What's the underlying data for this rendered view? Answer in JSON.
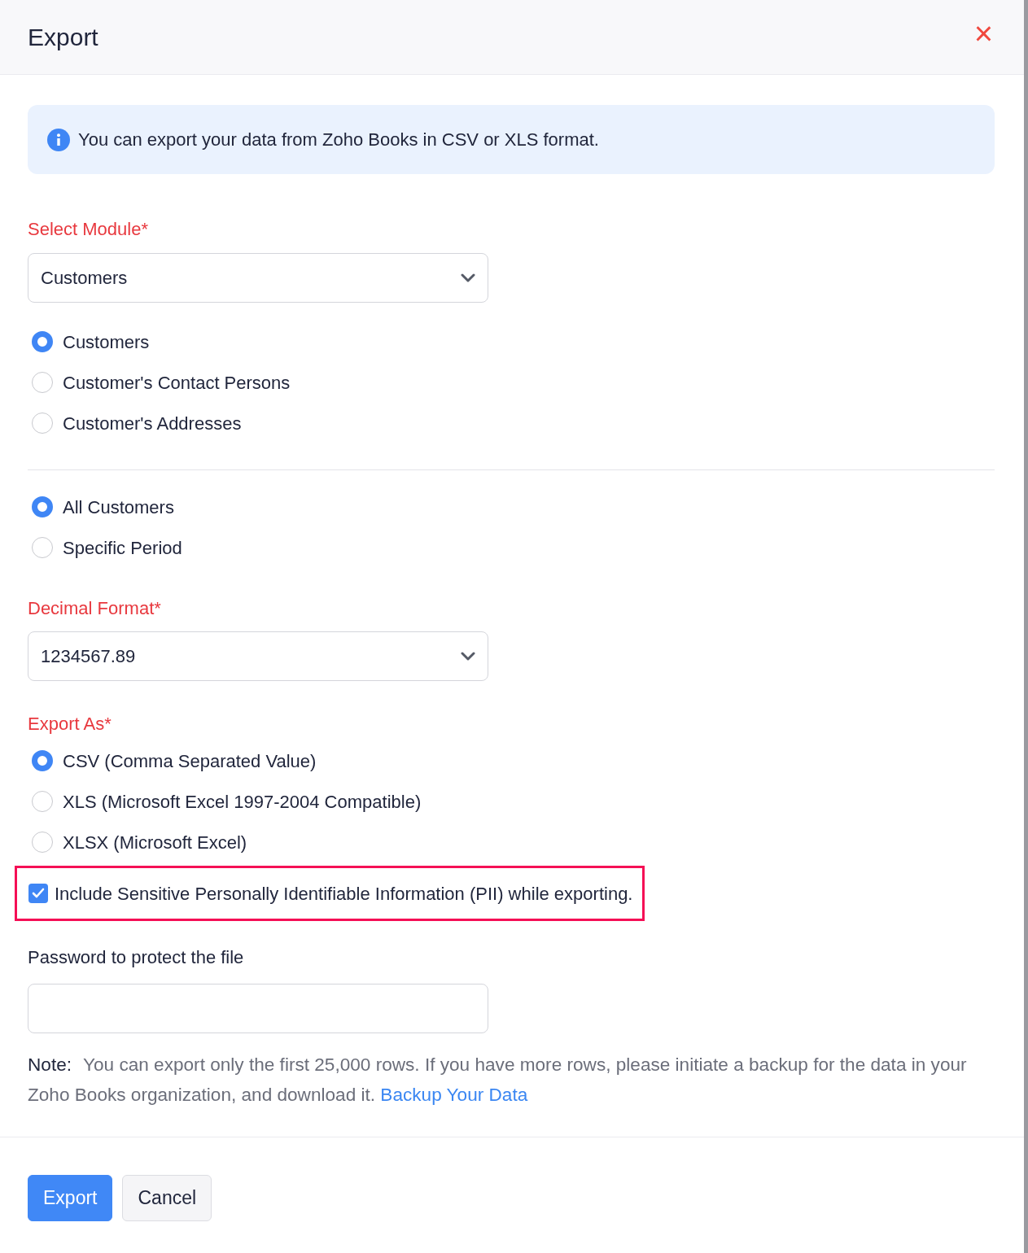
{
  "dialog": {
    "title": "Export",
    "close": "×"
  },
  "info_banner": {
    "text": "You can export your data from Zoho Books in CSV or XLS format."
  },
  "module": {
    "label": "Select Module*",
    "value": "Customers",
    "options": [
      {
        "label": "Customers",
        "selected": true
      },
      {
        "label": "Customer's Contact Persons",
        "selected": false
      },
      {
        "label": "Customer's Addresses",
        "selected": false
      }
    ]
  },
  "range": {
    "options": [
      {
        "label": "All Customers",
        "selected": true
      },
      {
        "label": "Specific Period",
        "selected": false
      }
    ]
  },
  "decimal_format": {
    "label": "Decimal Format*",
    "value": "1234567.89"
  },
  "export_as": {
    "label": "Export As*",
    "options": [
      {
        "label": "CSV (Comma Separated Value)",
        "selected": true
      },
      {
        "label": "XLS (Microsoft Excel 1997-2004 Compatible)",
        "selected": false
      },
      {
        "label": "XLSX (Microsoft Excel)",
        "selected": false
      }
    ]
  },
  "include_pii": {
    "label": "Include Sensitive Personally Identifiable Information (PII) while exporting.",
    "checked": true,
    "highlighted": true
  },
  "password": {
    "label": "Password to protect the file"
  },
  "note": {
    "prefix": "Note:",
    "text": "You can export only the first 25,000 rows. If you have more rows, please initiate a backup for the data in your Zoho Books organization, and download it.",
    "link": "Backup Your Data"
  },
  "buttons": [
    {
      "label": "Export",
      "kind": "primary"
    },
    {
      "label": "Cancel",
      "kind": "secondary"
    }
  ]
}
